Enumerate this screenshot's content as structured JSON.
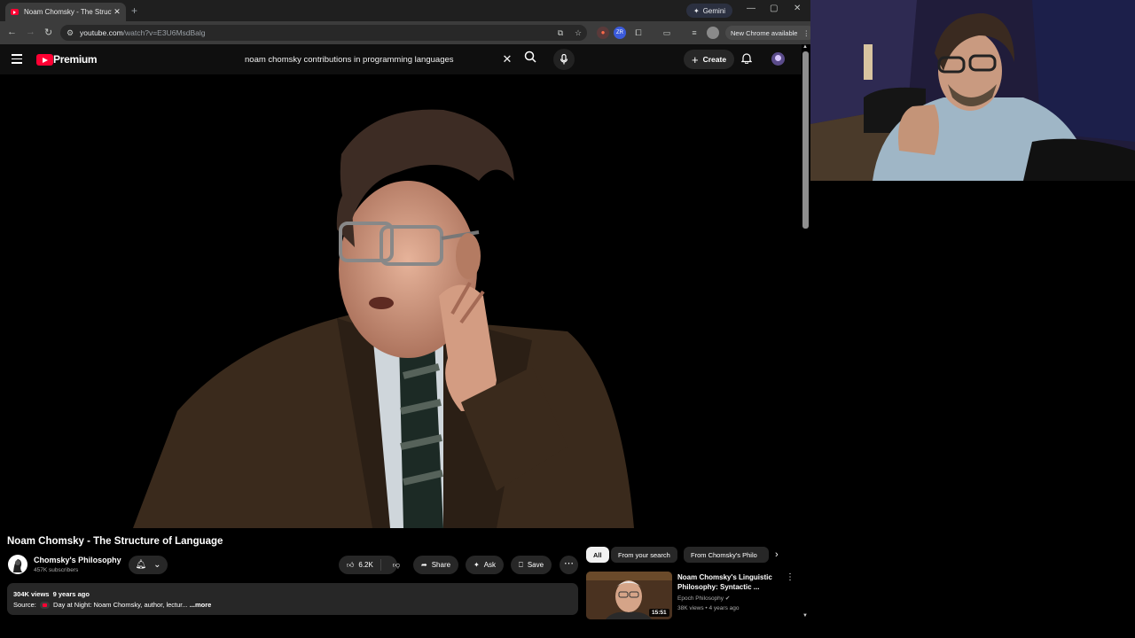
{
  "browser": {
    "tab_title": "Noam Chomsky - The Structure",
    "tab_close": "✕",
    "new_tab": "+",
    "gemini_label": "Gemini",
    "url_host": "youtube.com",
    "url_path": "/watch?v=E3U6MsdBalg",
    "new_chrome_label": "New Chrome available",
    "ext2_label": "ZR"
  },
  "youtube": {
    "brand": "Premium",
    "search_query": "noam chomsky contributions in programming languages",
    "create_label": "Create"
  },
  "video": {
    "title": "Noam Chomsky - The Structure of Language",
    "channel_name": "Chomsky's Philosophy",
    "subscribers": "457K subscribers",
    "likes": "6.2K",
    "share_label": "Share",
    "ask_label": "Ask",
    "save_label": "Save",
    "views": "304K views",
    "age": "9 years ago",
    "source_label": "Source:",
    "source_text": "Day at Night: Noam Chomsky, author, lectur...",
    "more_label": "...more"
  },
  "chips": [
    "All",
    "From your search",
    "From Chomsky's Philo"
  ],
  "recommended": [
    {
      "title": "Noam Chomsky's Linguistic Philosophy: Syntactic ...",
      "channel": "Epoch Philosophy",
      "meta": "38K views • 4 years ago",
      "duration": "15:51"
    }
  ],
  "colors": {
    "youtube_red": "#ff0033",
    "page_bg": "#0f0f0f",
    "chip_bg": "#272727"
  }
}
